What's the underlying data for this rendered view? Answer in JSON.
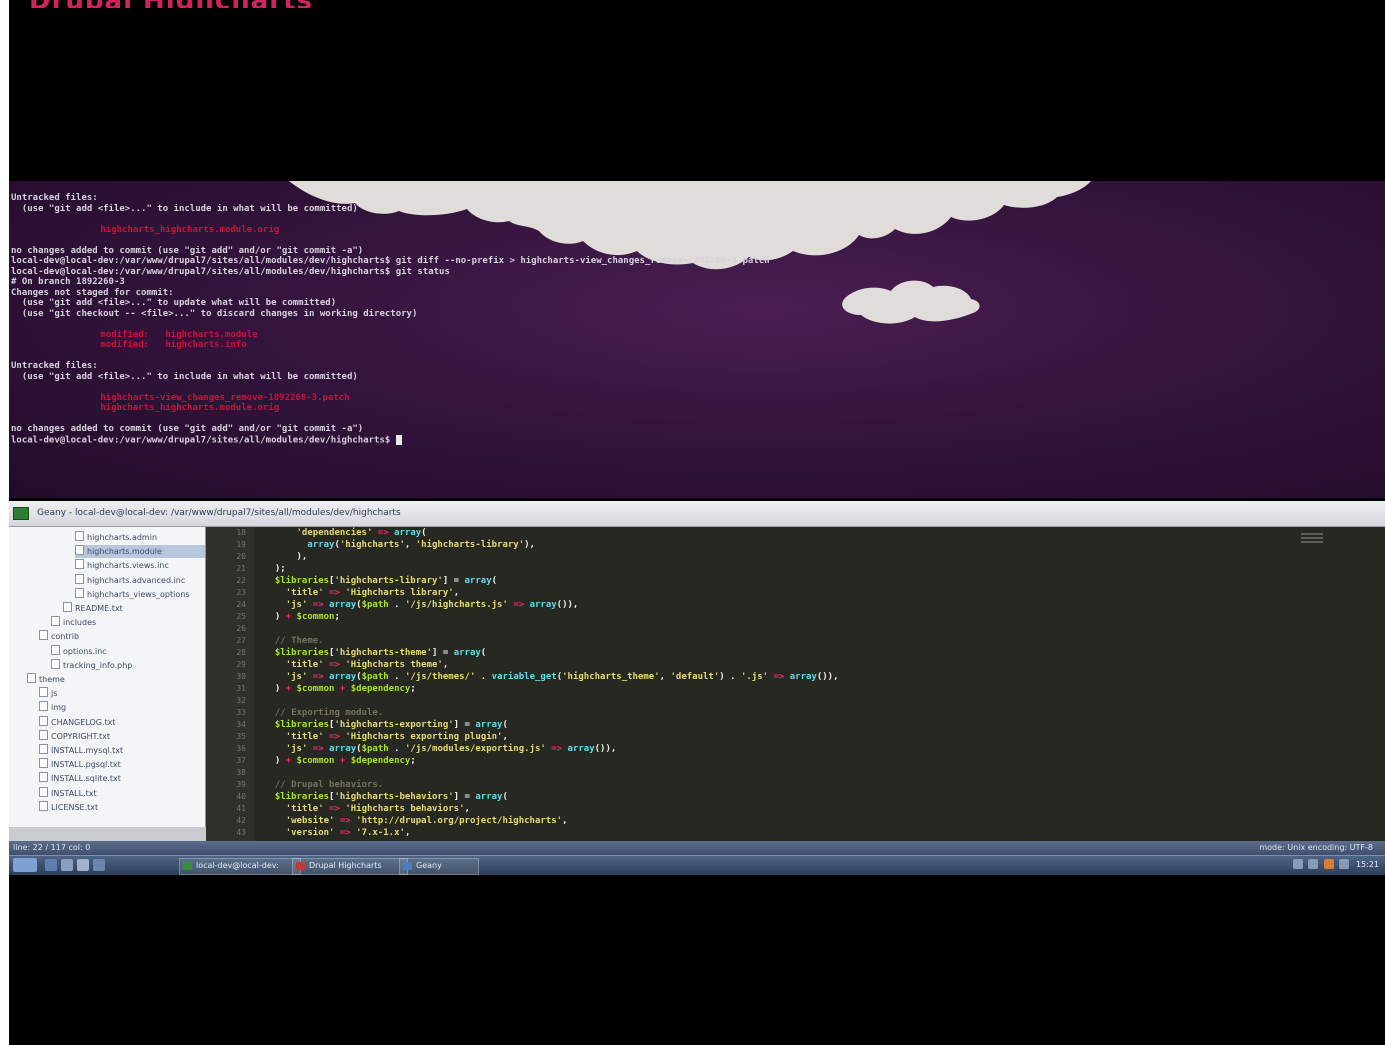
{
  "colors": {
    "title_accent": "#d1245d",
    "terminal_bg": "#34143d",
    "terminal_red": "#c9123a",
    "editor_bg": "#272822",
    "taskbar": "#2c3d58"
  },
  "video": {
    "title": "Drupal Highcharts"
  },
  "terminal": {
    "lines": [
      {
        "text": "Untracked files:",
        "red": false
      },
      {
        "text": "  (use \"git add <file>...\" to include in what will be committed)",
        "red": false
      },
      {
        "text": "",
        "red": false
      },
      {
        "text": "        highcharts_highcharts.module.orig",
        "red": true
      },
      {
        "text": "",
        "red": false
      },
      {
        "text": "no changes added to commit (use \"git add\" and/or \"git commit -a\")",
        "red": false
      },
      {
        "text": "local-dev@local-dev:/var/www/drupal7/sites/all/modules/dev/highcharts$ git diff --no-prefix > highcharts-view_changes_remove-1892260-3.patch",
        "red": false
      },
      {
        "text": "local-dev@local-dev:/var/www/drupal7/sites/all/modules/dev/highcharts$ git status",
        "red": false
      },
      {
        "text": "# On branch 1892260-3",
        "red": false
      },
      {
        "text": "Changes not staged for commit:",
        "red": false
      },
      {
        "text": "  (use \"git add <file>...\" to update what will be committed)",
        "red": false
      },
      {
        "text": "  (use \"git checkout -- <file>...\" to discard changes in working directory)",
        "red": false
      },
      {
        "text": "",
        "red": false
      },
      {
        "text": "        modified:   highcharts.module",
        "red": true
      },
      {
        "text": "        modified:   highcharts.info",
        "red": true
      },
      {
        "text": "",
        "red": false
      },
      {
        "text": "Untracked files:",
        "red": false
      },
      {
        "text": "  (use \"git add <file>...\" to include in what will be committed)",
        "red": false
      },
      {
        "text": "",
        "red": false
      },
      {
        "text": "        highcharts-view_changes_remove-1892260-3.patch",
        "red": true
      },
      {
        "text": "        highcharts_highcharts.module.orig",
        "red": true
      },
      {
        "text": "",
        "red": false
      },
      {
        "text": "no changes added to commit (use \"git add\" and/or \"git commit -a\")",
        "red": false
      },
      {
        "text": "local-dev@local-dev:/var/www/drupal7/sites/all/modules/dev/highcharts$ ",
        "red": false,
        "cursor": true
      }
    ]
  },
  "ide": {
    "title": "Geany - local-dev@local-dev: /var/www/drupal7/sites/all/modules/dev/highcharts",
    "tree": [
      {
        "label": "highcharts.admin",
        "indent": 5
      },
      {
        "label": "highcharts.module",
        "indent": 5,
        "selected": true
      },
      {
        "label": "highcharts.views.inc",
        "indent": 5
      },
      {
        "label": "highcharts.advanced.inc",
        "indent": 5
      },
      {
        "label": "highcharts_views_options",
        "indent": 5
      },
      {
        "label": "README.txt",
        "indent": 4
      },
      {
        "label": "includes",
        "indent": 3
      },
      {
        "label": "contrib",
        "indent": 2
      },
      {
        "label": "options.inc",
        "indent": 3
      },
      {
        "label": "tracking_info.php",
        "indent": 3
      },
      {
        "label": "theme",
        "indent": 1
      },
      {
        "label": "js",
        "indent": 2
      },
      {
        "label": "img",
        "indent": 2
      },
      {
        "label": "CHANGELOG.txt",
        "indent": 2
      },
      {
        "label": "COPYRIGHT.txt",
        "indent": 2
      },
      {
        "label": "INSTALL.mysql.txt",
        "indent": 2
      },
      {
        "label": "INSTALL.pgsql.txt",
        "indent": 2
      },
      {
        "label": "INSTALL.sqlite.txt",
        "indent": 2
      },
      {
        "label": "INSTALL.txt",
        "indent": 2
      },
      {
        "label": "LICENSE.txt",
        "indent": 2
      }
    ],
    "gutter_start": 18,
    "code": [
      "      'dependencies' => array(",
      "        array('highcharts', 'highcharts-library'),",
      "      ),",
      "  );",
      "  $libraries['highcharts-library'] = array(",
      "    'title' => 'Highcharts library',",
      "    'js' => array($path . '/js/highcharts.js' => array()),",
      "  ) + $common;",
      "",
      "  // Theme.",
      "  $libraries['highcharts-theme'] = array(",
      "    'title' => 'Highcharts theme',",
      "    'js' => array($path . '/js/themes/' . variable_get('highcharts_theme', 'default') . '.js' => array()),",
      "  ) + $common + $dependency;",
      "",
      "  // Exporting module.",
      "  $libraries['highcharts-exporting'] = array(",
      "    'title' => 'Highcharts exporting plugin',",
      "    'js' => array($path . '/js/modules/exporting.js' => array()),",
      "  ) + $common + $dependency;",
      "",
      "  // Drupal behaviors.",
      "  $libraries['highcharts-behaviors'] = array(",
      "    'title' => 'Highcharts behaviors',",
      "    'website' => 'http://drupal.org/project/highcharts',",
      "    'version' => '7.x-1.x',"
    ],
    "status_left": "line: 22 / 117   col: 0",
    "status_right": "mode: Unix   encoding: UTF-8"
  },
  "taskbar": {
    "tasks": [
      {
        "label": "local-dev@local-dev:",
        "color": "#3a8f3a"
      },
      {
        "label": "Drupal Highcharts",
        "color": "#c23b3b"
      },
      {
        "label": "Geany",
        "color": "#4a7cc2"
      }
    ],
    "clock": "15:21"
  }
}
